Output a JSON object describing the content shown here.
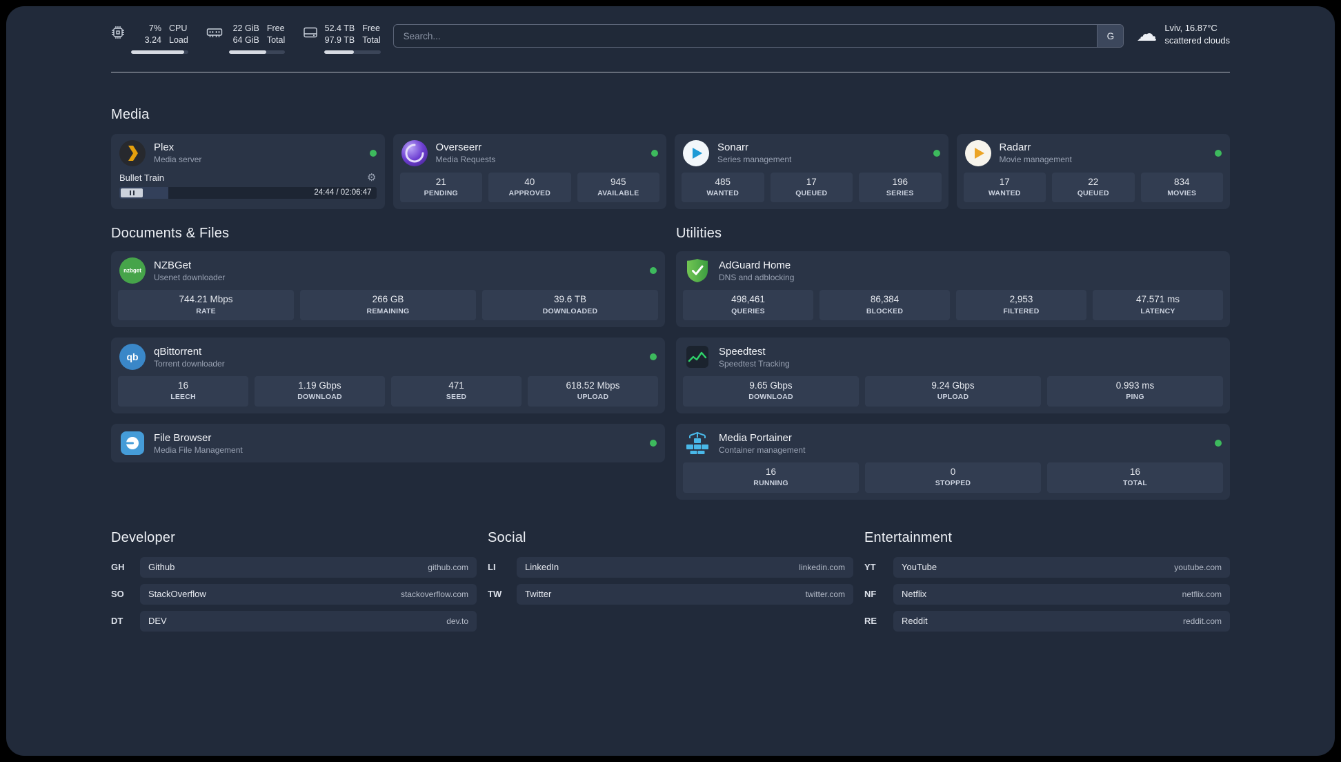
{
  "topbar": {
    "cpu": {
      "value_primary": "7%",
      "value_secondary": "3.24",
      "label_primary": "CPU",
      "label_secondary": "Load",
      "bar_percent": 93
    },
    "ram": {
      "value_primary": "22 GiB",
      "value_secondary": "64 GiB",
      "label_primary": "Free",
      "label_secondary": "Total",
      "bar_percent": 66
    },
    "disk": {
      "value_primary": "52.4 TB",
      "value_secondary": "97.9 TB",
      "label_primary": "Free",
      "label_secondary": "Total",
      "bar_percent": 52
    },
    "search": {
      "placeholder": "Search...",
      "engine_button": "G"
    },
    "weather": {
      "location": "Lviv, 16.87°C",
      "condition": "scattered clouds"
    }
  },
  "media": {
    "title": "Media",
    "plex": {
      "name": "Plex",
      "subtitle": "Media server",
      "now_playing": "Bullet Train",
      "time": "24:44 / 02:06:47",
      "progress_percent": 19
    },
    "overseerr": {
      "name": "Overseerr",
      "subtitle": "Media Requests",
      "stats": [
        {
          "value": "21",
          "label": "PENDING"
        },
        {
          "value": "40",
          "label": "APPROVED"
        },
        {
          "value": "945",
          "label": "AVAILABLE"
        }
      ]
    },
    "sonarr": {
      "name": "Sonarr",
      "subtitle": "Series management",
      "stats": [
        {
          "value": "485",
          "label": "WANTED"
        },
        {
          "value": "17",
          "label": "QUEUED"
        },
        {
          "value": "196",
          "label": "SERIES"
        }
      ]
    },
    "radarr": {
      "name": "Radarr",
      "subtitle": "Movie management",
      "stats": [
        {
          "value": "17",
          "label": "WANTED"
        },
        {
          "value": "22",
          "label": "QUEUED"
        },
        {
          "value": "834",
          "label": "MOVIES"
        }
      ]
    }
  },
  "documents": {
    "title": "Documents & Files",
    "nzbget": {
      "name": "NZBGet",
      "subtitle": "Usenet downloader",
      "stats": [
        {
          "value": "744.21 Mbps",
          "label": "RATE"
        },
        {
          "value": "266 GB",
          "label": "REMAINING"
        },
        {
          "value": "39.6 TB",
          "label": "DOWNLOADED"
        }
      ]
    },
    "qbittorrent": {
      "name": "qBittorrent",
      "subtitle": "Torrent downloader",
      "stats": [
        {
          "value": "16",
          "label": "LEECH"
        },
        {
          "value": "1.19 Gbps",
          "label": "DOWNLOAD"
        },
        {
          "value": "471",
          "label": "SEED"
        },
        {
          "value": "618.52 Mbps",
          "label": "UPLOAD"
        }
      ]
    },
    "filebrowser": {
      "name": "File Browser",
      "subtitle": "Media File Management"
    }
  },
  "utilities": {
    "title": "Utilities",
    "adguard": {
      "name": "AdGuard Home",
      "subtitle": "DNS and adblocking",
      "stats": [
        {
          "value": "498,461",
          "label": "QUERIES"
        },
        {
          "value": "86,384",
          "label": "BLOCKED"
        },
        {
          "value": "2,953",
          "label": "FILTERED"
        },
        {
          "value": "47.571 ms",
          "label": "LATENCY"
        }
      ]
    },
    "speedtest": {
      "name": "Speedtest",
      "subtitle": "Speedtest Tracking",
      "stats": [
        {
          "value": "9.65 Gbps",
          "label": "DOWNLOAD"
        },
        {
          "value": "9.24 Gbps",
          "label": "UPLOAD"
        },
        {
          "value": "0.993 ms",
          "label": "PING"
        }
      ]
    },
    "portainer": {
      "name": "Media Portainer",
      "subtitle": "Container management",
      "stats": [
        {
          "value": "16",
          "label": "RUNNING"
        },
        {
          "value": "0",
          "label": "STOPPED"
        },
        {
          "value": "16",
          "label": "TOTAL"
        }
      ]
    }
  },
  "bookmarks": {
    "developer": {
      "title": "Developer",
      "links": [
        {
          "abbr": "GH",
          "name": "Github",
          "url": "github.com"
        },
        {
          "abbr": "SO",
          "name": "StackOverflow",
          "url": "stackoverflow.com"
        },
        {
          "abbr": "DT",
          "name": "DEV",
          "url": "dev.to"
        }
      ]
    },
    "social": {
      "title": "Social",
      "links": [
        {
          "abbr": "LI",
          "name": "LinkedIn",
          "url": "linkedin.com"
        },
        {
          "abbr": "TW",
          "name": "Twitter",
          "url": "twitter.com"
        }
      ]
    },
    "entertainment": {
      "title": "Entertainment",
      "links": [
        {
          "abbr": "YT",
          "name": "YouTube",
          "url": "youtube.com"
        },
        {
          "abbr": "NF",
          "name": "Netflix",
          "url": "netflix.com"
        },
        {
          "abbr": "RE",
          "name": "Reddit",
          "url": "reddit.com"
        }
      ]
    }
  }
}
